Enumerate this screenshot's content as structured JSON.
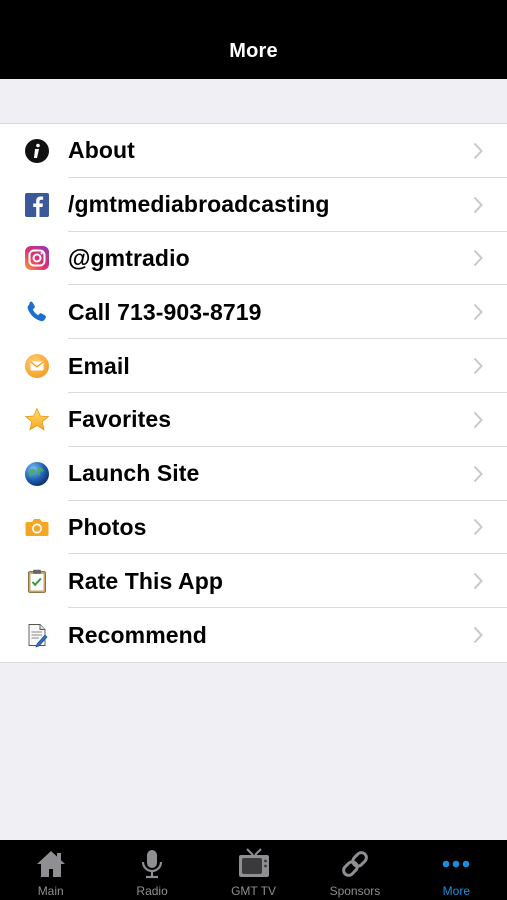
{
  "navbar": {
    "title": "More"
  },
  "menu": {
    "items": [
      {
        "label": "About",
        "icon": "info-icon"
      },
      {
        "label": "/gmtmediabroadcasting",
        "icon": "facebook-icon"
      },
      {
        "label": "@gmtradio",
        "icon": "instagram-icon"
      },
      {
        "label": "Call 713-903-8719",
        "icon": "phone-icon"
      },
      {
        "label": "Email",
        "icon": "email-icon"
      },
      {
        "label": "Favorites",
        "icon": "star-icon"
      },
      {
        "label": "Launch Site",
        "icon": "globe-icon"
      },
      {
        "label": "Photos",
        "icon": "camera-icon"
      },
      {
        "label": "Rate This App",
        "icon": "clipboard-icon"
      },
      {
        "label": "Recommend",
        "icon": "document-icon"
      }
    ]
  },
  "tabbar": {
    "tabs": [
      {
        "label": "Main",
        "icon": "home-icon"
      },
      {
        "label": "Radio",
        "icon": "microphone-icon"
      },
      {
        "label": "GMT TV",
        "icon": "tv-icon"
      },
      {
        "label": "Sponsors",
        "icon": "link-icon"
      },
      {
        "label": "More",
        "icon": "more-icon",
        "active": true
      }
    ]
  },
  "colors": {
    "accent": "#1c8dde",
    "inactive_tab": "#8e8e93",
    "background": "#efeff4"
  }
}
